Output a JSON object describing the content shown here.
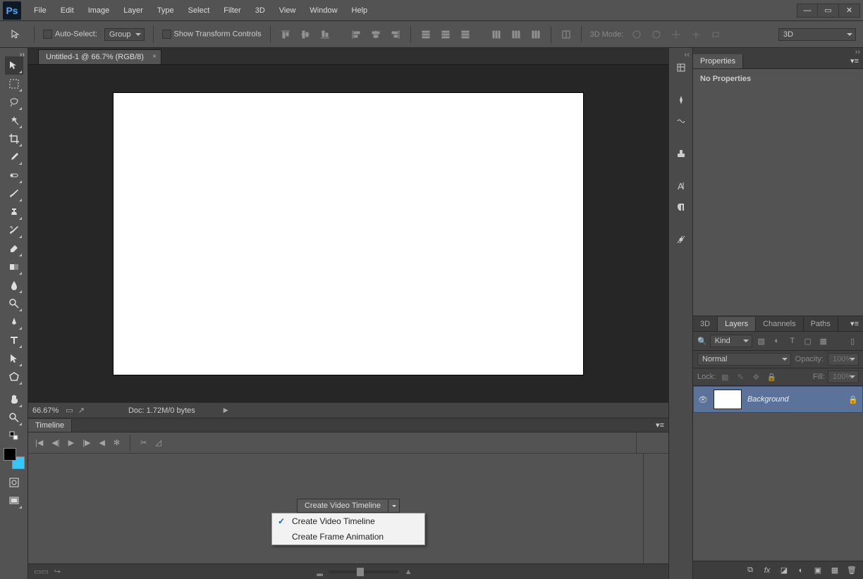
{
  "app": {
    "logo": "Ps"
  },
  "menu": [
    "File",
    "Edit",
    "Image",
    "Layer",
    "Type",
    "Select",
    "Filter",
    "3D",
    "View",
    "Window",
    "Help"
  ],
  "options": {
    "autoSelect": "Auto-Select:",
    "autoSelectTarget": "Group",
    "showTransform": "Show Transform Controls",
    "mode3d": "3D Mode:",
    "dropdown3d": "3D"
  },
  "document": {
    "tab": "Untitled-1 @ 66.7% (RGB/8)",
    "zoom": "66.67%",
    "docinfo": "Doc: 1.72M/0 bytes"
  },
  "timeline": {
    "title": "Timeline",
    "createBtn": "Create Video Timeline",
    "menu": [
      {
        "label": "Create Video Timeline",
        "checked": true
      },
      {
        "label": "Create Frame Animation",
        "checked": false
      }
    ]
  },
  "properties": {
    "title": "Properties",
    "empty": "No Properties"
  },
  "layersPanel": {
    "tabs": [
      "3D",
      "Layers",
      "Channels",
      "Paths"
    ],
    "activeTab": 1,
    "kind": "Kind",
    "blend": "Normal",
    "opacityLabel": "Opacity:",
    "opacityVal": "100%",
    "lockLabel": "Lock:",
    "fillLabel": "Fill:",
    "fillVal": "100%",
    "layer": {
      "name": "Background"
    }
  },
  "icons": {
    "min": "—",
    "max": "▭",
    "close": "✕",
    "tri": "▶",
    "eye": "👁",
    "lock": "🔒",
    "fx": "fx",
    "link": "⧉",
    "mask": "◐",
    "adj": "◑",
    "folder": "▣",
    "new": "▦",
    "trash": "🗑"
  }
}
